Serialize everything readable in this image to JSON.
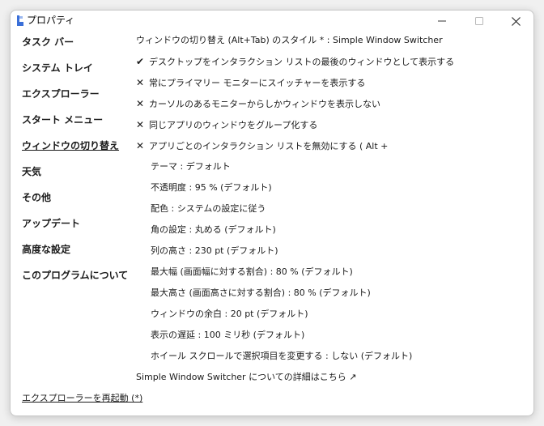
{
  "window": {
    "title": "プロパティ"
  },
  "sidebar": {
    "items": [
      {
        "label": "タスク バー"
      },
      {
        "label": "システム トレイ"
      },
      {
        "label": "エクスプローラー"
      },
      {
        "label": "スタート メニュー"
      },
      {
        "label": "ウィンドウの切り替え",
        "active": true
      },
      {
        "label": "天気"
      },
      {
        "label": "その他"
      },
      {
        "label": "アップデート"
      },
      {
        "label": "高度な設定"
      },
      {
        "label": "このプログラムについて"
      }
    ],
    "restart_link": "エクスプローラーを再起動 (*)"
  },
  "main": {
    "heading": "ウィンドウの切り替え (Alt+Tab) のスタイル * : Simple Window Switcher",
    "checks": [
      {
        "mark": "✔",
        "label": "デスクトップをインタラクション リストの最後のウィンドウとして表示する"
      },
      {
        "mark": "✕",
        "label": "常にプライマリー モニターにスイッチャーを表示する"
      },
      {
        "mark": "✕",
        "label": "カーソルのあるモニターからしかウィンドウを表示しない"
      },
      {
        "mark": "✕",
        "label": "同じアプリのウィンドウをグループ化する"
      },
      {
        "mark": "✕",
        "label": "アプリごとのインタラクション リストを無効にする ( Alt +"
      }
    ],
    "settings": [
      {
        "label": "テーマ : デフォルト"
      },
      {
        "label": "不透明度 : 95 % (デフォルト)"
      },
      {
        "label": "配色 : システムの設定に従う"
      },
      {
        "label": "角の設定 : 丸める (デフォルト)"
      },
      {
        "label": "列の高さ : 230 pt (デフォルト)"
      },
      {
        "label": "最大幅 (画面幅に対する割合) : 80 % (デフォルト)"
      },
      {
        "label": "最大高さ (画面高さに対する割合) : 80 % (デフォルト)"
      },
      {
        "label": "ウィンドウの余白 : 20 pt (デフォルト)"
      },
      {
        "label": "表示の遅延 : 100 ミリ秒 (デフォルト)"
      },
      {
        "label": "ホイール スクロールで選択項目を変更する : しない (デフォルト)"
      }
    ],
    "more_info": "Simple Window Switcher についての詳細はこちら ↗"
  }
}
